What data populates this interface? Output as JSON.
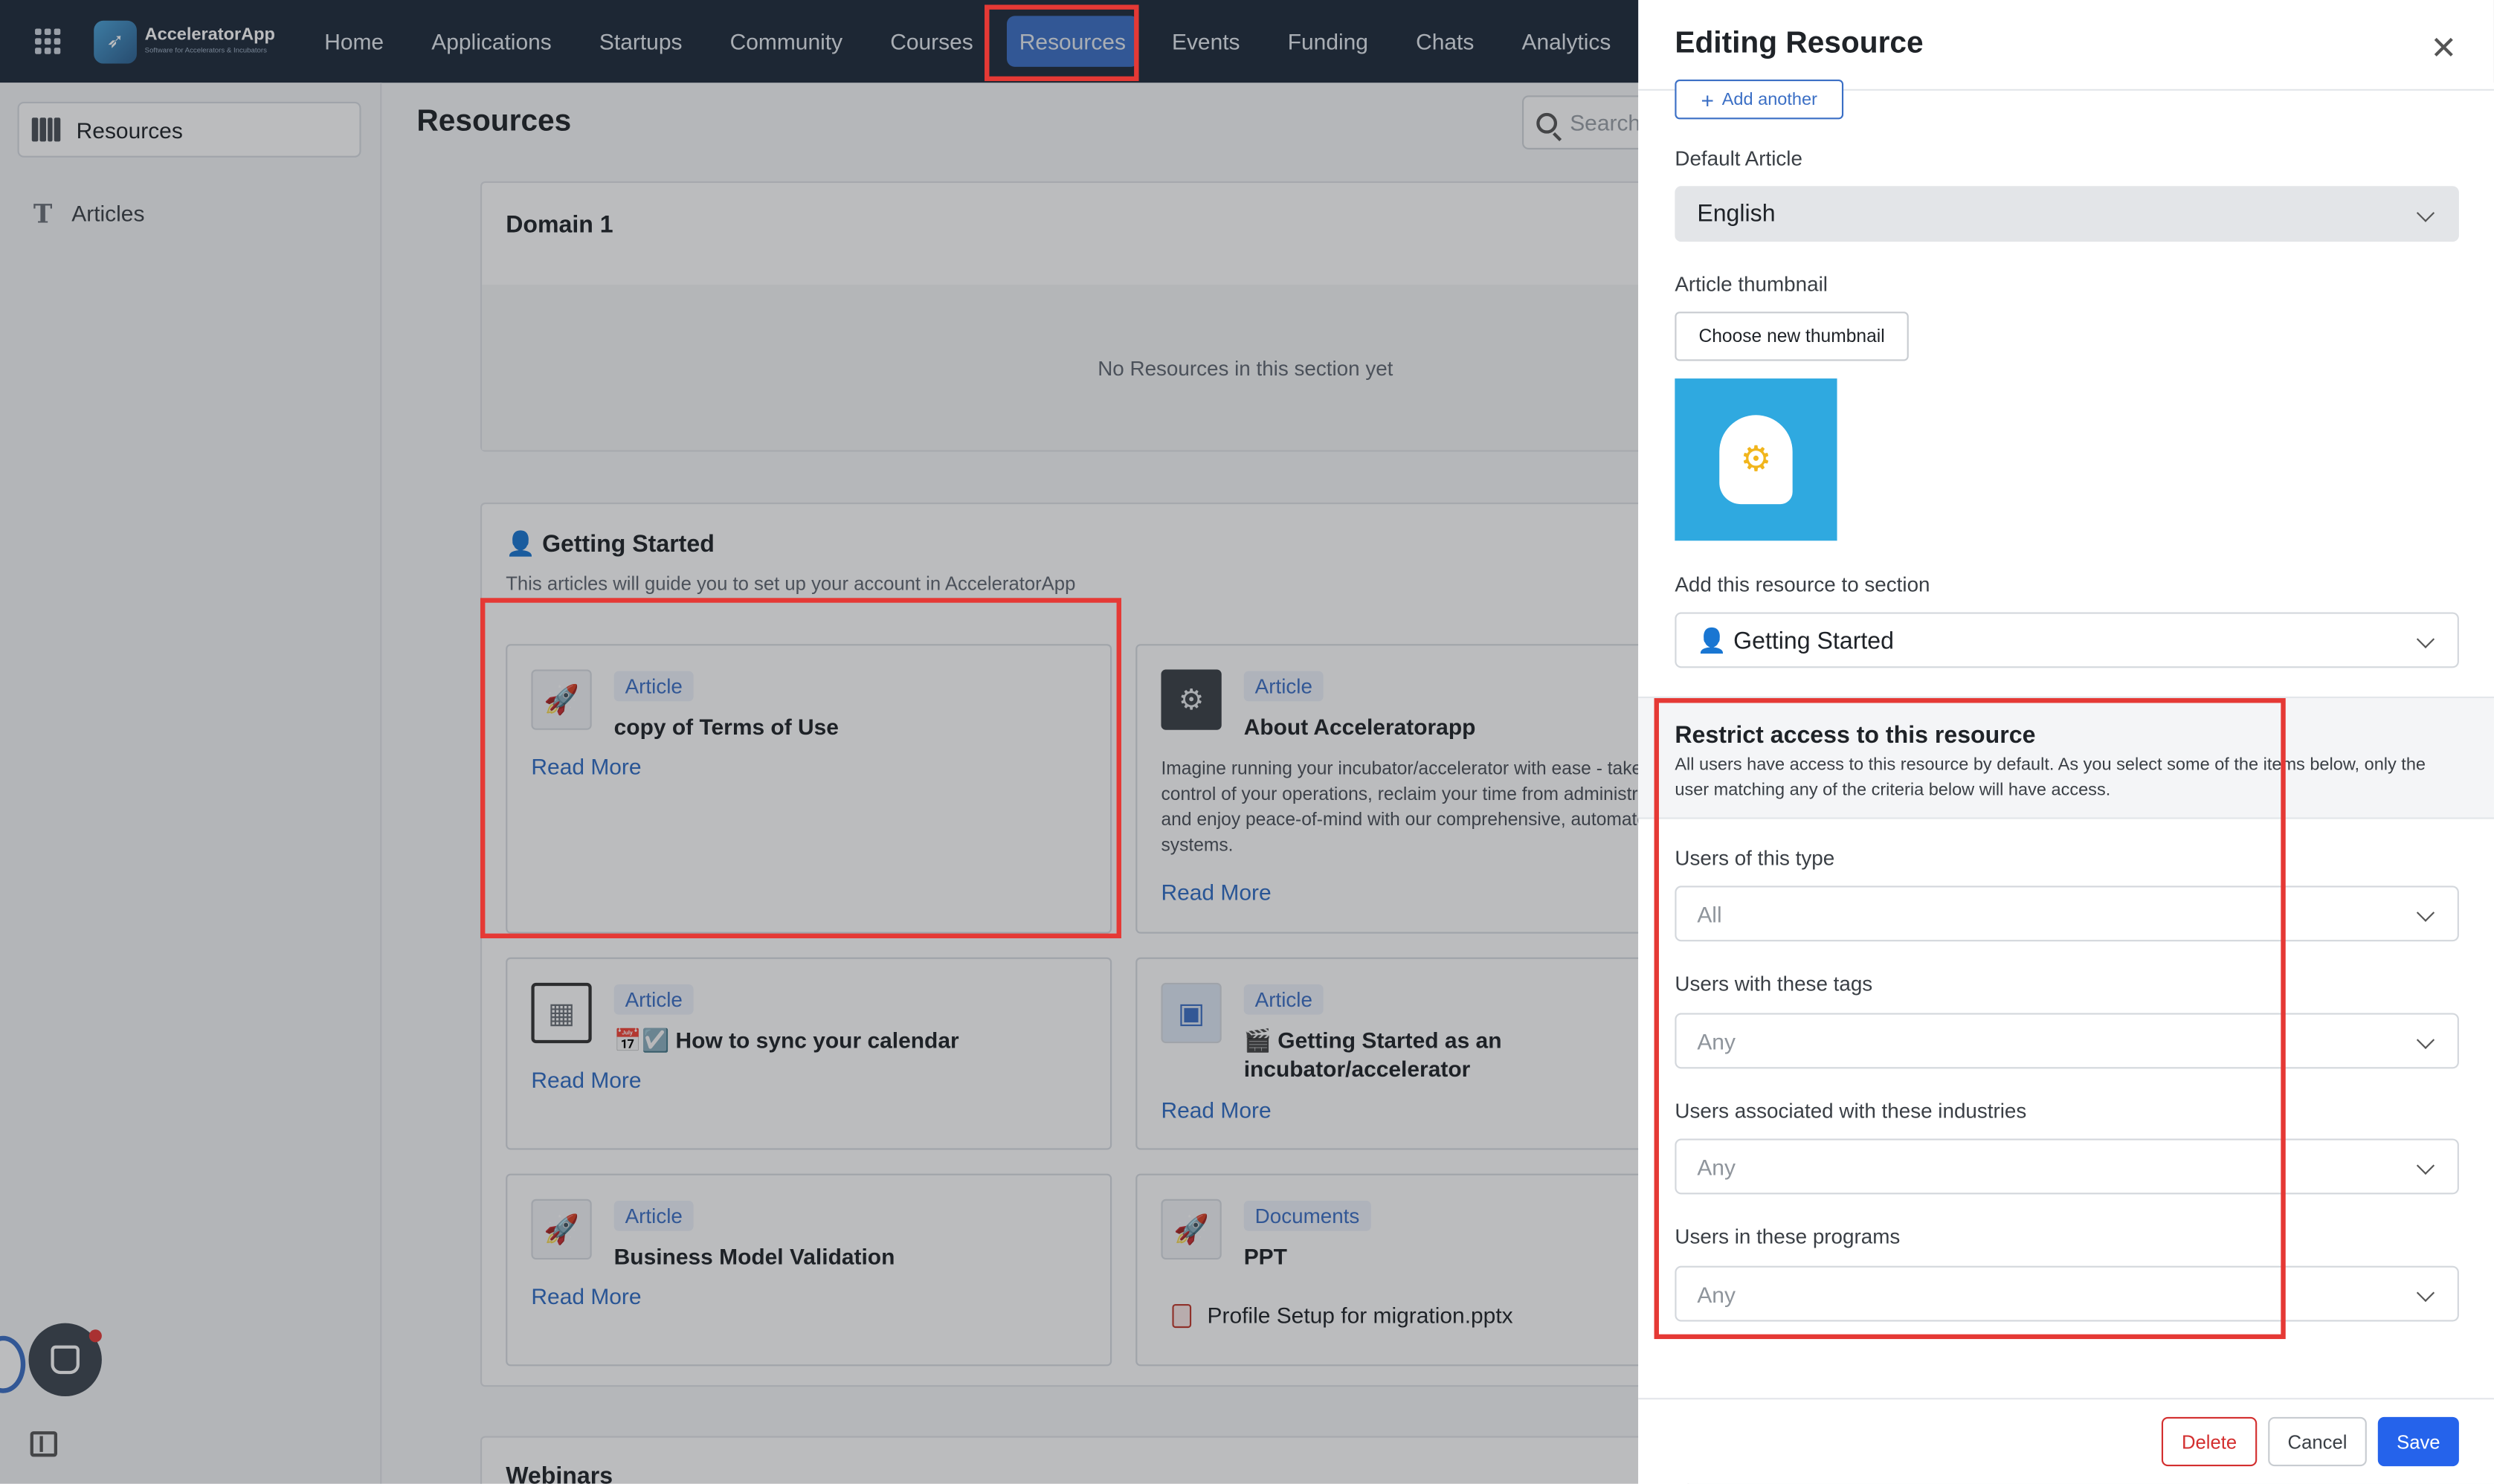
{
  "app": {
    "name": "AcceleratorApp",
    "tagline": "Software for Accelerators & Incubators"
  },
  "nav": {
    "items": [
      {
        "label": "Home"
      },
      {
        "label": "Applications"
      },
      {
        "label": "Startups"
      },
      {
        "label": "Community"
      },
      {
        "label": "Courses"
      },
      {
        "label": "Resources",
        "active": true
      },
      {
        "label": "Events"
      },
      {
        "label": "Funding"
      },
      {
        "label": "Chats"
      },
      {
        "label": "Analytics"
      }
    ]
  },
  "sidebar": {
    "items": [
      {
        "label": "Resources",
        "icon": "books-icon",
        "active": true
      },
      {
        "label": "Articles",
        "icon": "text-icon"
      }
    ]
  },
  "main": {
    "title": "Resources",
    "search_placeholder": "Search",
    "sections": [
      {
        "title": "Domain 1",
        "empty_text": "No Resources in this section yet"
      },
      {
        "title": "👤 Getting Started",
        "description": "This articles will guide you to set up your account in AcceleratorApp",
        "cards": [
          {
            "badge": "Article",
            "title": "copy of Terms of Use",
            "read_more": "Read More",
            "icon": "rocket-icon"
          },
          {
            "badge": "Article",
            "title": "About Acceleratorapp",
            "description": "Imagine running your incubator/accelerator with ease - take logistical control of your operations, reclaim your time from administrative tasks, and enjoy peace-of-mind with our comprehensive, automated systems.",
            "read_more": "Read More",
            "icon": "gear-icon"
          },
          {
            "badge": "Article",
            "title": "📅☑️ How to sync your calendar",
            "read_more": "Read More",
            "icon": "calendar-icon"
          },
          {
            "badge": "Article",
            "title": "🎬 Getting Started as an incubator/accelerator",
            "read_more": "Read More",
            "icon": "image-icon"
          },
          {
            "badge": "Article",
            "title": "Business Model Validation",
            "read_more": "Read More",
            "icon": "rocket-icon"
          },
          {
            "badge": "Documents",
            "title": "PPT",
            "file": "Profile Setup for migration.pptx",
            "icon": "rocket-icon"
          }
        ]
      },
      {
        "title": "Webinars"
      }
    ]
  },
  "panel": {
    "title": "Editing Resource",
    "add_another": "Add another",
    "default_article_label": "Default Article",
    "default_article_value": "English",
    "thumbnail_label": "Article thumbnail",
    "choose_thumbnail": "Choose new thumbnail",
    "section_label": "Add this resource to section",
    "section_value": "👤 Getting Started",
    "restrict_title": "Restrict access to this resource",
    "restrict_desc": "All users have access to this resource by default. As you select some of the items below, only the user matching any of the criteria below will have access.",
    "filters": [
      {
        "label": "Users of this type",
        "value": "All"
      },
      {
        "label": "Users with these tags",
        "value": "Any"
      },
      {
        "label": "Users associated with these industries",
        "value": "Any"
      },
      {
        "label": "Users in these programs",
        "value": "Any"
      }
    ],
    "buttons": {
      "delete": "Delete",
      "cancel": "Cancel",
      "save": "Save"
    }
  },
  "colors": {
    "nav_bg": "#1e2a3a",
    "accent": "#3b6fc5",
    "highlight": "#e53935",
    "save": "#2563eb"
  }
}
